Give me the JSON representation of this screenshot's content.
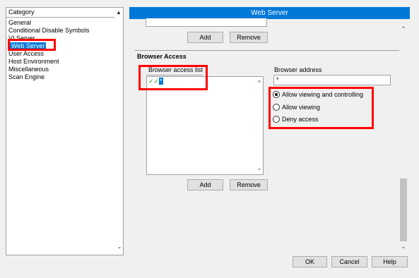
{
  "category_list": {
    "header": "Category",
    "items": [
      "General",
      "Conditional Disable Symbols",
      "VI Server",
      "Web Server",
      "User Access",
      "Host Environment",
      "Miscellaneous",
      "Scan Engine"
    ],
    "selected": "Web Server"
  },
  "pane": {
    "title": "Web Server",
    "top_buttons": {
      "add": "Add",
      "remove": "Remove"
    },
    "browser_access": {
      "section_title": "Browser Access",
      "list_label": "Browser access list",
      "list_entries": [
        {
          "marker": "✓✓",
          "text": "*"
        }
      ],
      "list_buttons": {
        "add": "Add",
        "remove": "Remove"
      },
      "address_label": "Browser address",
      "address_value": "*",
      "options": [
        {
          "label": "Allow viewing and controlling",
          "selected": true
        },
        {
          "label": "Allow viewing",
          "selected": false
        },
        {
          "label": "Deny access",
          "selected": false
        }
      ]
    }
  },
  "footer": {
    "ok": "OK",
    "cancel": "Cancel",
    "help": "Help"
  },
  "colors": {
    "accent": "#0078d7",
    "highlight": "#ff0000",
    "check": "#1a8f1a"
  }
}
